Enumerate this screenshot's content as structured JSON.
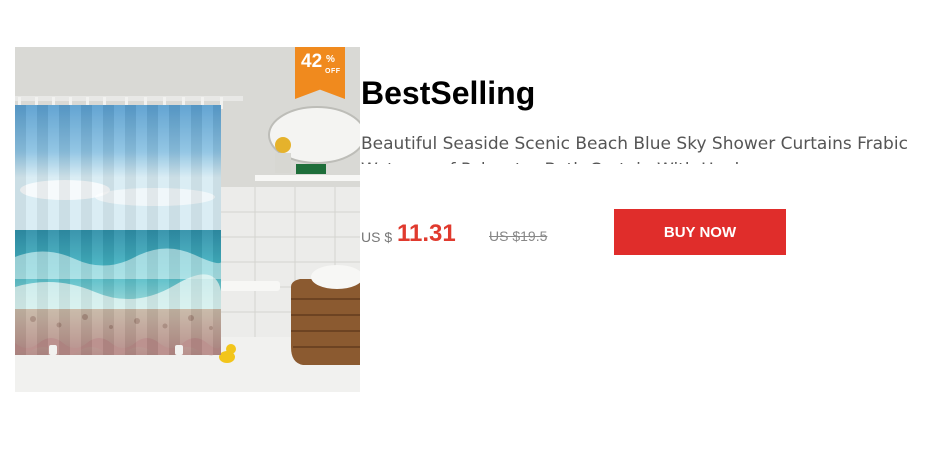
{
  "product": {
    "image_alt": "Seaside scenic beach shower curtain",
    "discount": {
      "number": "42",
      "sign": "%",
      "off_label": "OFF"
    },
    "section_title": "BestSelling",
    "name": "Beautiful Seaside Scenic Beach Blue Sky Shower Curtains Frabic Waterproof Polyester Bath Curtain With Hooks",
    "currency_label": "US $",
    "price": "11.31",
    "old_price": "US $19.5",
    "buy_label": "BUY NOW"
  },
  "colors": {
    "badge": "#f08a1e",
    "price": "#e03a2e",
    "buy_button": "#e02d2b"
  }
}
